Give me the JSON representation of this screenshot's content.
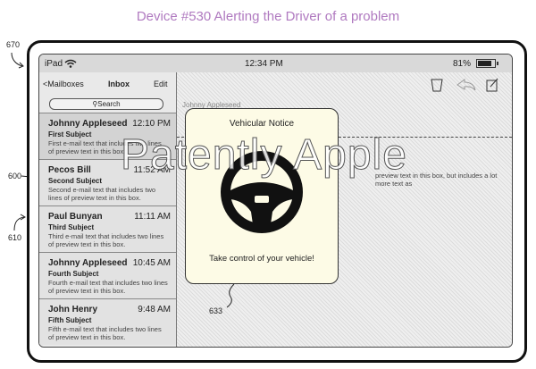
{
  "headline": "Device #530 Alerting the Driver of a problem",
  "refs": {
    "device": "670",
    "list": "600",
    "item": "610",
    "modal": "633"
  },
  "status": {
    "device": "iPad",
    "time": "12:34 PM",
    "battery": "81%",
    "battery_level": 0.81
  },
  "nav": {
    "back": "<Mailboxes",
    "title": "Inbox",
    "edit": "Edit"
  },
  "search": {
    "placeholder": "Search"
  },
  "mails": [
    {
      "sender": "Johnny Appleseed",
      "time": "12:10 PM",
      "subject": "First Subject",
      "preview": "First e-mail text that includes two lines of preview text in this box."
    },
    {
      "sender": "Pecos Bill",
      "time": "11:52 AM",
      "subject": "Second Subject",
      "preview": "Second e-mail text that includes two lines of preview text in this box."
    },
    {
      "sender": "Paul Bunyan",
      "time": "11:11 AM",
      "subject": "Third Subject",
      "preview": "Third e-mail text that includes two lines of preview text in this box."
    },
    {
      "sender": "Johnny Appleseed",
      "time": "10:45 AM",
      "subject": "Fourth Subject",
      "preview": "Fourth e-mail text that includes two lines of preview text in this box."
    },
    {
      "sender": "John Henry",
      "time": "9:48 AM",
      "subject": "Fifth Subject",
      "preview": "Fifth e-mail text that includes two lines of preview text in this box."
    }
  ],
  "reader": {
    "from": "Johnny Appleseed",
    "body": "preview text in this box, but includes a lot more text as"
  },
  "toolbar": {
    "icons": [
      "trash-icon",
      "reply-icon",
      "compose-icon"
    ]
  },
  "alert": {
    "title": "Vehicular Notice",
    "message": "Take control of your vehicle!",
    "icon": "steering-wheel-icon"
  },
  "watermark": "Patently Apple"
}
